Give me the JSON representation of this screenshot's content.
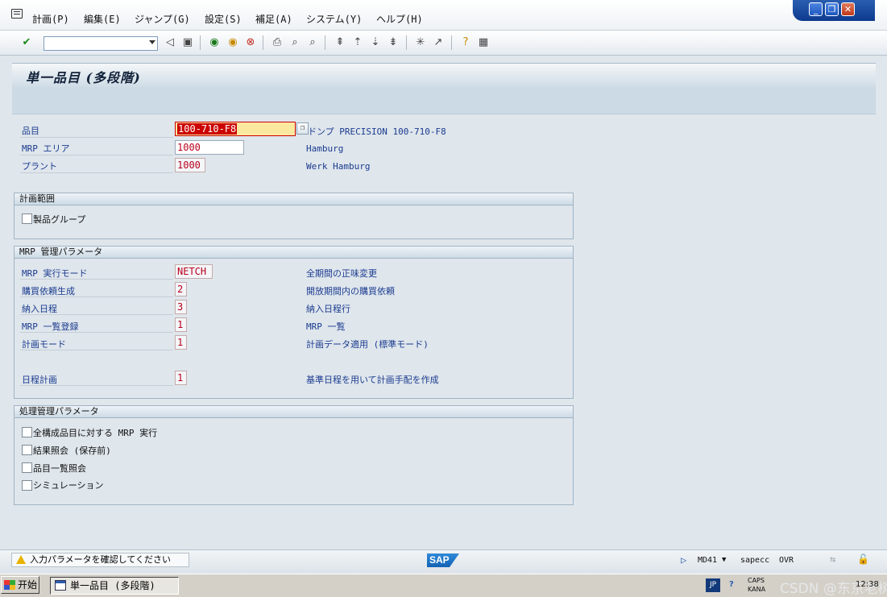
{
  "menubar": {
    "items": [
      "計画(P)",
      "編集(E)",
      "ジャンプ(G)",
      "設定(S)",
      "補足(A)",
      "システム(Y)",
      "ヘルプ(H)"
    ]
  },
  "window_controls": {
    "minimize": "_",
    "restore": "❐",
    "close": "✕"
  },
  "toolbar": {
    "command_value": ""
  },
  "page": {
    "title": "単一品目 (多段階)"
  },
  "header_fields": {
    "material": {
      "label": "品目",
      "value": "100-710-F8",
      "desc": "ドンプ PRECISION 100-710-F8"
    },
    "mrp_area": {
      "label": "MRP エリア",
      "value": "1000",
      "desc": "Hamburg"
    },
    "plant": {
      "label": "プラント",
      "value": "1000",
      "desc": "Werk Hamburg"
    }
  },
  "planning_scope": {
    "title": "計画範囲",
    "product_group": {
      "label": "製品グループ",
      "checked": false
    }
  },
  "mrp_control": {
    "title": "MRP 管理パラメータ",
    "fields": [
      {
        "label": "MRP 実行モード",
        "value": "NETCH",
        "desc": "全期間の正味変更"
      },
      {
        "label": "購買依頼生成",
        "value": "2",
        "desc": "開放期間内の購買依頼"
      },
      {
        "label": "納入日程",
        "value": "3",
        "desc": "納入日程行"
      },
      {
        "label": "MRP 一覧登録",
        "value": "1",
        "desc": "MRP 一覧"
      },
      {
        "label": "計画モード",
        "value": "1",
        "desc": "計画データ適用 (標準モード)"
      },
      {
        "label": "日程計画",
        "value": "1",
        "desc": "基準日程を用いて計画手配を作成"
      }
    ]
  },
  "process_control": {
    "title": "処理管理パラメータ",
    "options": [
      {
        "label": "全構成品目に対する MRP 実行",
        "checked": false
      },
      {
        "label": "結果照会 (保存前)",
        "checked": false
      },
      {
        "label": "品目一覧照会",
        "checked": false
      },
      {
        "label": "シミュレーション",
        "checked": false
      }
    ]
  },
  "statusbar": {
    "message": "入力パラメータを確認してください",
    "logo": "SAP",
    "transaction": "MD41",
    "server": "sapecc",
    "mode": "OVR"
  },
  "taskbar": {
    "start": "开始",
    "task": "単一品目 (多段階)",
    "lang": "JP",
    "caps": "CAPS",
    "kana": "KANA",
    "watermark": "CSDN @东京老树根",
    "time": "12:38"
  },
  "colors": {
    "label_blue": "#1b3b8f",
    "value_red": "#b8001c",
    "focus_yellow": "#fce9a0",
    "background": "#dfe6ec"
  }
}
